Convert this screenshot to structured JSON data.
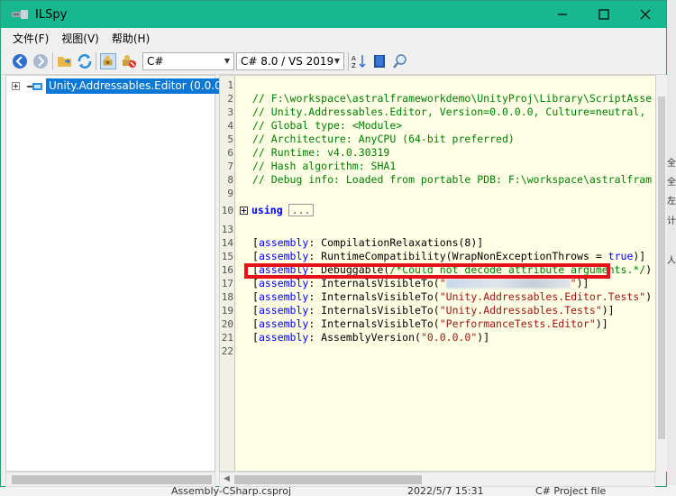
{
  "background": {
    "bottom_file": "Assembly-CSharp.csproj",
    "bottom_date": "2022/5/7 15:31",
    "bottom_type": "C# Project file"
  },
  "window": {
    "title": "ILSpy",
    "accent": "#17b890"
  },
  "menu": [
    "文件(F)",
    "视图(V)",
    "帮助(H)"
  ],
  "toolbar": {
    "language": "C#",
    "language_version": "C# 8.0 / VS 2019",
    "icons": [
      "back-icon",
      "forward-icon",
      "open-folder-icon",
      "refresh-icon",
      "show-api-icon",
      "show-all-icon",
      "sort-icon",
      "manual-icon",
      "search-icon"
    ]
  },
  "tree": {
    "root_label": "Unity.Addressables.Editor (0.0.0"
  },
  "code": {
    "lines": [
      {
        "n": "1",
        "parts": []
      },
      {
        "n": "2",
        "parts": [
          {
            "c": "comment",
            "t": "// F:\\workspace\\astralframeworkdemo\\UnityProj\\Library\\ScriptAsse"
          }
        ]
      },
      {
        "n": "3",
        "parts": [
          {
            "c": "comment",
            "t": "// Unity.Addressables.Editor, Version=0.0.0.0, Culture=neutral,"
          }
        ]
      },
      {
        "n": "4",
        "parts": [
          {
            "c": "comment",
            "t": "// Global type: <Module>"
          }
        ]
      },
      {
        "n": "5",
        "parts": [
          {
            "c": "comment",
            "t": "// Architecture: AnyCPU (64-bit preferred)"
          }
        ]
      },
      {
        "n": "6",
        "parts": [
          {
            "c": "comment",
            "t": "// Runtime: v4.0.30319"
          }
        ]
      },
      {
        "n": "7",
        "parts": [
          {
            "c": "comment",
            "t": "// Hash algorithm: SHA1"
          }
        ]
      },
      {
        "n": "8",
        "parts": [
          {
            "c": "comment",
            "t": "// Debug info: Loaded from portable PDB: F:\\workspace\\astralfram"
          }
        ]
      },
      {
        "n": "9",
        "parts": []
      },
      {
        "n": "10",
        "parts": []
      },
      {
        "n": "13",
        "parts": []
      },
      {
        "n": "14",
        "parts": [
          {
            "c": "plain",
            "t": "["
          },
          {
            "c": "kw",
            "t": "assembly"
          },
          {
            "c": "plain",
            "t": ": CompilationRelaxations(8)]"
          }
        ]
      },
      {
        "n": "15",
        "parts": [
          {
            "c": "plain",
            "t": "["
          },
          {
            "c": "kw",
            "t": "assembly"
          },
          {
            "c": "plain",
            "t": ": RuntimeCompatibility(WrapNonExceptionThrows = "
          },
          {
            "c": "kw",
            "t": "true"
          },
          {
            "c": "plain",
            "t": ")]"
          }
        ]
      },
      {
        "n": "16",
        "parts": [
          {
            "c": "plain",
            "t": "["
          },
          {
            "c": "kw",
            "t": "assembly"
          },
          {
            "c": "plain",
            "t": ": Debuggable("
          },
          {
            "c": "comment",
            "t": "/*Could not decode attribute arguments.*/"
          },
          {
            "c": "plain",
            "t": ")"
          }
        ]
      },
      {
        "n": "17",
        "parts": []
      },
      {
        "n": "18",
        "parts": [
          {
            "c": "plain",
            "t": "["
          },
          {
            "c": "kw",
            "t": "assembly"
          },
          {
            "c": "plain",
            "t": ": InternalsVisibleTo("
          },
          {
            "c": "str",
            "t": "\"Unity.Addressables.Editor.Tests\""
          },
          {
            "c": "plain",
            "t": ")"
          }
        ]
      },
      {
        "n": "19",
        "parts": [
          {
            "c": "plain",
            "t": "["
          },
          {
            "c": "kw",
            "t": "assembly"
          },
          {
            "c": "plain",
            "t": ": InternalsVisibleTo("
          },
          {
            "c": "str",
            "t": "\"Unity.Addressables.Tests\""
          },
          {
            "c": "plain",
            "t": ")]"
          }
        ]
      },
      {
        "n": "20",
        "parts": [
          {
            "c": "plain",
            "t": "["
          },
          {
            "c": "kw",
            "t": "assembly"
          },
          {
            "c": "plain",
            "t": ": InternalsVisibleTo("
          },
          {
            "c": "str",
            "t": "\"PerformanceTests.Editor\""
          },
          {
            "c": "plain",
            "t": ")]"
          }
        ]
      },
      {
        "n": "21",
        "parts": [
          {
            "c": "plain",
            "t": "["
          },
          {
            "c": "kw",
            "t": "assembly"
          },
          {
            "c": "plain",
            "t": ": AssemblyVersion("
          },
          {
            "c": "str",
            "t": "\"0.0.0.0\""
          },
          {
            "c": "plain",
            "t": ")]"
          }
        ]
      },
      {
        "n": "22",
        "parts": []
      }
    ],
    "using_keyword": "using",
    "using_collapsed": "...",
    "line17": {
      "open": "[",
      "kw": "assembly",
      "mid": ": InternalsVisibleTo(",
      "str_start": "\"",
      "str_end": "\"",
      "close": ")]"
    },
    "highlight_color": "#e8101a"
  }
}
